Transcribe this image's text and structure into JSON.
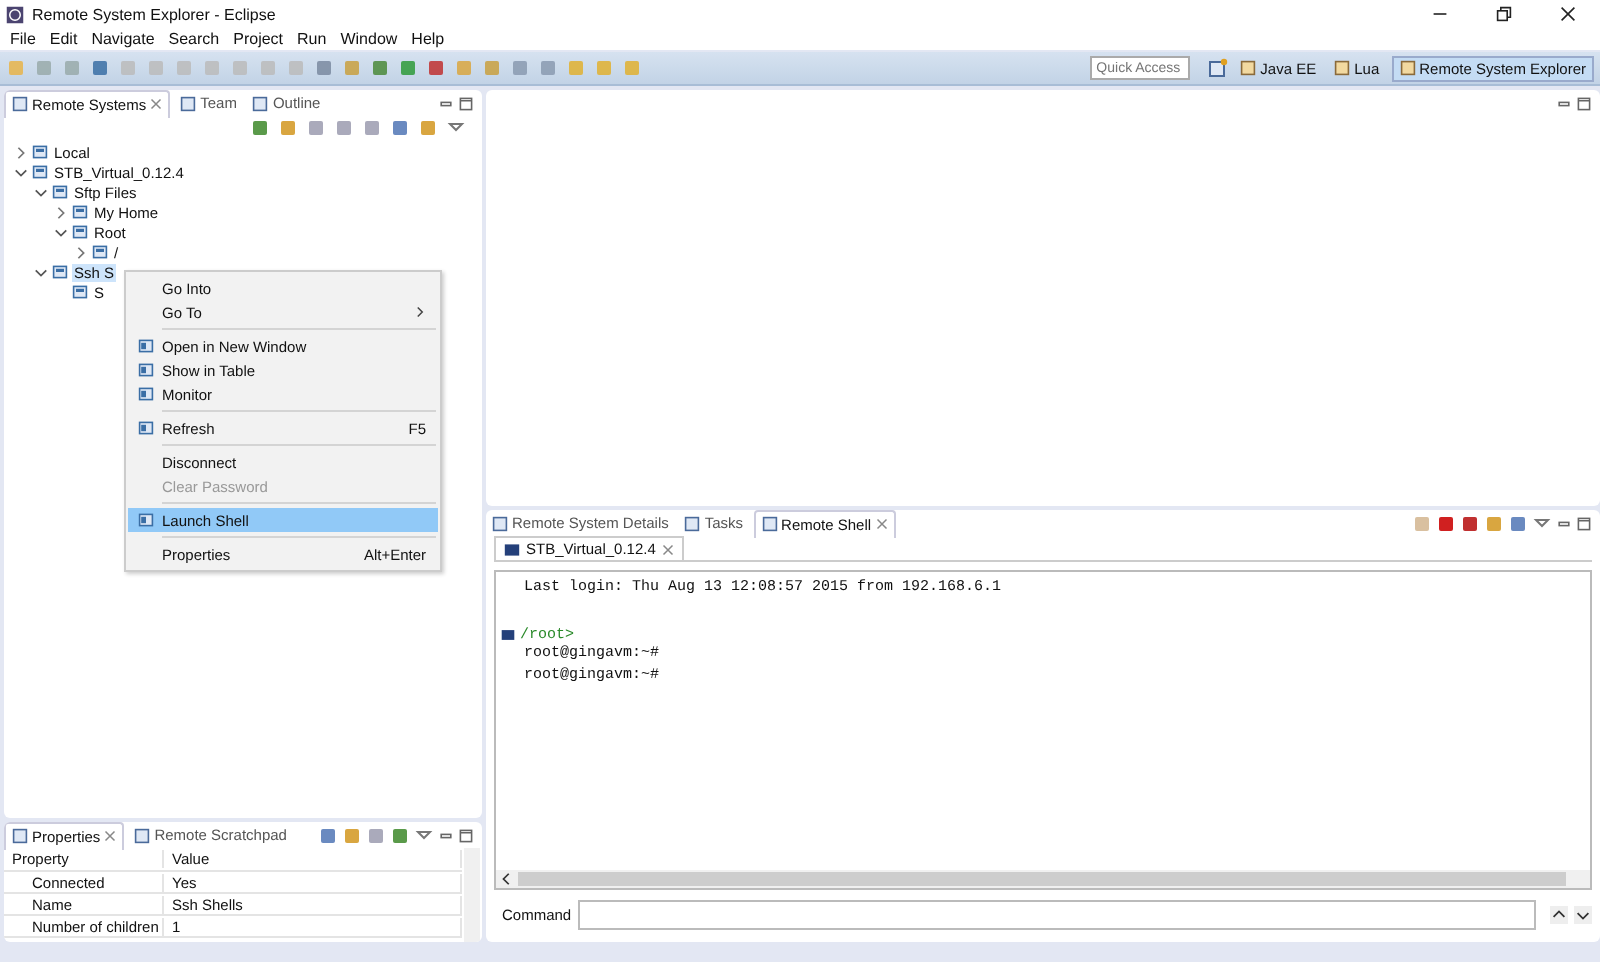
{
  "window": {
    "title": "Remote System Explorer - Eclipse"
  },
  "menu_bar": [
    "File",
    "Edit",
    "Navigate",
    "Search",
    "Project",
    "Run",
    "Window",
    "Help"
  ],
  "quick_access": {
    "placeholder": "Quick Access"
  },
  "perspectives": [
    {
      "label": "Java EE",
      "selected": false
    },
    {
      "label": "Lua",
      "selected": false
    },
    {
      "label": "Remote System Explorer",
      "selected": true
    }
  ],
  "remote_systems_view": {
    "tabs": [
      {
        "label": "Remote Systems",
        "selected": true
      },
      {
        "label": "Team",
        "selected": false
      },
      {
        "label": "Outline",
        "selected": false
      }
    ],
    "tree": [
      {
        "label": "Local",
        "expanded": false,
        "selected": false
      },
      {
        "label": "STB_Virtual_0.12.4",
        "expanded": true,
        "selected": false,
        "children": [
          {
            "label": "Sftp Files",
            "expanded": true,
            "selected": false,
            "children": [
              {
                "label": "My Home",
                "expanded": false,
                "selected": false
              },
              {
                "label": "Root",
                "expanded": true,
                "selected": false,
                "children": [
                  {
                    "label": "/",
                    "expanded": false,
                    "selected": false
                  }
                ]
              }
            ]
          },
          {
            "label": "Ssh S",
            "expanded": true,
            "selected": true,
            "children": [
              {
                "label": "S",
                "selected": false
              }
            ]
          }
        ]
      }
    ]
  },
  "context_menu": {
    "items": [
      {
        "kind": "item",
        "label": "Go Into",
        "icon": false,
        "submenu": false,
        "disabled": false,
        "selected": false
      },
      {
        "kind": "item",
        "label": "Go To",
        "icon": false,
        "submenu": true,
        "disabled": false,
        "selected": false
      },
      {
        "kind": "separator"
      },
      {
        "kind": "item",
        "label": "Open in New Window",
        "icon": true,
        "submenu": false,
        "disabled": false,
        "selected": false
      },
      {
        "kind": "item",
        "label": "Show in Table",
        "icon": true,
        "submenu": false,
        "disabled": false,
        "selected": false
      },
      {
        "kind": "item",
        "label": "Monitor",
        "icon": true,
        "submenu": false,
        "disabled": false,
        "selected": false
      },
      {
        "kind": "separator"
      },
      {
        "kind": "item",
        "label": "Refresh",
        "shortcut": "F5",
        "icon": true,
        "submenu": false,
        "disabled": false,
        "selected": false
      },
      {
        "kind": "separator"
      },
      {
        "kind": "item",
        "label": "Disconnect",
        "icon": false,
        "submenu": false,
        "disabled": false,
        "selected": false
      },
      {
        "kind": "item",
        "label": "Clear Password",
        "icon": false,
        "submenu": false,
        "disabled": true,
        "selected": false
      },
      {
        "kind": "separator"
      },
      {
        "kind": "item",
        "label": "Launch Shell",
        "icon": true,
        "submenu": false,
        "disabled": false,
        "selected": true
      },
      {
        "kind": "separator"
      },
      {
        "kind": "item",
        "label": "Properties",
        "shortcut": "Alt+Enter",
        "icon": false,
        "submenu": false,
        "disabled": false,
        "selected": false
      }
    ]
  },
  "properties_view": {
    "tabs": [
      {
        "label": "Properties",
        "selected": true
      },
      {
        "label": "Remote Scratchpad",
        "selected": false
      }
    ],
    "columns": [
      "Property",
      "Value"
    ],
    "rows": [
      [
        "Connected",
        "Yes"
      ],
      [
        "Name",
        "Ssh Shells"
      ],
      [
        "Number of children",
        "1"
      ]
    ]
  },
  "shell_view": {
    "tabs": [
      {
        "label": "Remote System Details",
        "selected": false
      },
      {
        "label": "Tasks",
        "selected": false
      },
      {
        "label": "Remote Shell",
        "selected": true
      }
    ],
    "session_tab": "STB_Virtual_0.12.4",
    "lines": [
      {
        "kind": "output",
        "text": "Last login: Thu Aug 13 12:08:57 2015 from 192.168.6.1"
      },
      {
        "kind": "blank"
      },
      {
        "kind": "prompt",
        "text": "/root>"
      },
      {
        "kind": "output",
        "text": "root@gingavm:~#"
      },
      {
        "kind": "output",
        "text": "root@gingavm:~#"
      }
    ],
    "command": {
      "label": "Command"
    }
  }
}
